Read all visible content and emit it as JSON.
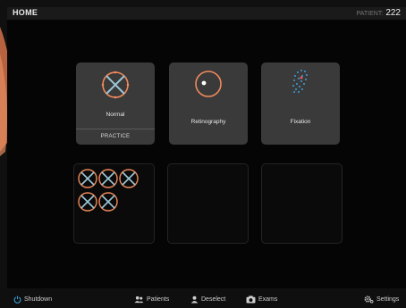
{
  "header": {
    "title": "HOME",
    "patient_label": "PATIENT:",
    "patient_id": "222"
  },
  "tiles": [
    {
      "label": "Normal",
      "sub_label": "PRACTICE",
      "icon": "cross-circle-icon"
    },
    {
      "label": "Retinography",
      "icon": "retina-circle-icon"
    },
    {
      "label": "Fixation",
      "icon": "fixation-dots-icon"
    }
  ],
  "footer": {
    "shutdown": "Shutdown",
    "patients": "Patients",
    "deselect": "Deselect",
    "exams": "Exams",
    "settings": "Settings"
  },
  "colors": {
    "accent": "#f08a5c",
    "fixation": "#3b9fd8",
    "icon_center": "#9cc8d8"
  }
}
